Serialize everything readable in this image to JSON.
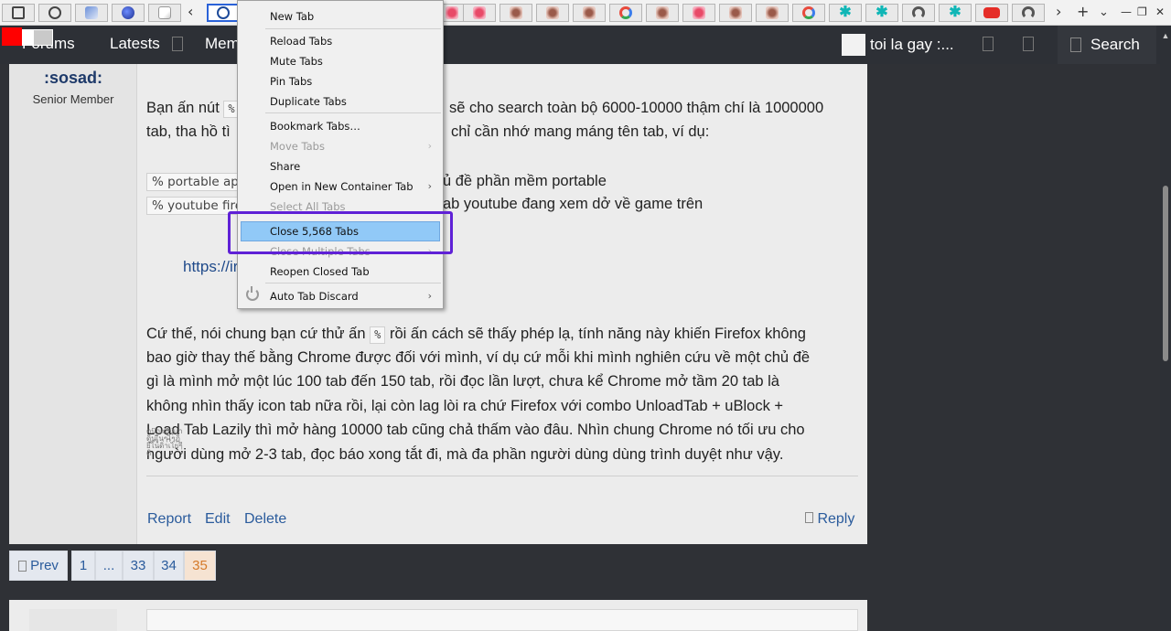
{
  "browser": {
    "tabs": [
      {
        "icon": "puzzle-icon"
      },
      {
        "icon": "gear-icon"
      },
      {
        "icon": "wave-favicon"
      },
      {
        "icon": "globe-favicon"
      },
      {
        "icon": "page-favicon"
      },
      {
        "icon": "wordpress-favicon"
      },
      {
        "icon": "pink-favicon"
      },
      {
        "icon": "pink-favicon"
      },
      {
        "icon": "ameba-favicon"
      },
      {
        "icon": "ameba-favicon"
      },
      {
        "icon": "ameba-favicon"
      },
      {
        "icon": "google-favicon"
      },
      {
        "icon": "ameba-favicon"
      },
      {
        "icon": "pink-favicon"
      },
      {
        "icon": "ameba-favicon"
      },
      {
        "icon": "ameba-favicon"
      },
      {
        "icon": "google-favicon"
      },
      {
        "icon": "star-favicon"
      },
      {
        "icon": "star-favicon"
      },
      {
        "icon": "github-favicon"
      },
      {
        "icon": "star-favicon"
      },
      {
        "icon": "youtube-favicon"
      },
      {
        "icon": "github-favicon"
      }
    ],
    "window_controls": [
      "+",
      "⌄",
      "—",
      "❐",
      "✕"
    ]
  },
  "context_menu": {
    "items": [
      {
        "label": "New Tab",
        "disabled": false,
        "submenu": false
      },
      {
        "label": "Reload Tabs",
        "disabled": false,
        "submenu": false
      },
      {
        "label": "Mute Tabs",
        "disabled": false,
        "submenu": false
      },
      {
        "label": "Pin Tabs",
        "disabled": false,
        "submenu": false
      },
      {
        "label": "Duplicate Tabs",
        "disabled": false,
        "submenu": false
      },
      {
        "label": "Bookmark Tabs…",
        "disabled": false,
        "submenu": false
      },
      {
        "label": "Move Tabs",
        "disabled": true,
        "submenu": true
      },
      {
        "label": "Share",
        "disabled": false,
        "submenu": false
      },
      {
        "label": "Open in New Container Tab",
        "disabled": false,
        "submenu": true
      },
      {
        "label": "Select All Tabs",
        "disabled": true,
        "submenu": false
      },
      {
        "label": "Close 5,568 Tabs",
        "disabled": false,
        "submenu": false,
        "highlighted": true
      },
      {
        "label": "Close Multiple Tabs",
        "disabled": true,
        "submenu": true
      },
      {
        "label": "Reopen Closed Tab",
        "disabled": false,
        "submenu": false
      },
      {
        "label": "Auto Tab Discard",
        "disabled": false,
        "submenu": true
      }
    ]
  },
  "site_header": {
    "forums": "Forums",
    "latests": "Latests",
    "members": "Mem",
    "user_title": "toi la gay :...",
    "search": "Search"
  },
  "post": {
    "author_name": ":sosad:",
    "author_role": "Senior Member",
    "p1_line1_a": "Bạn ấn nút",
    "p1_line1_code": "%",
    "p1_line1_b": "sẽ cho search toàn bộ 6000-10000 thậm chí là 1000000",
    "p1_line2_a": "tab, tha hồ tì",
    "p1_line2_b": "chỉ cần nhớ mang máng tên tab, ví dụ:",
    "code1": "% portable app",
    "code1_desc": "ủ đề phần mềm portable",
    "code2": "% youtube fire",
    "code2_desc": "ab youtube đang xem dở về game trên",
    "link": "https://ir",
    "p2_line1_a": "Cứ thế, nói chung bạn cứ thử ấn",
    "p2_line1_code": "%",
    "p2_line1_b": "rồi ấn cách sẽ thấy phép lạ, tính năng này khiến Firefox không",
    "p2_line2": "bao giờ thay thế bằng Chrome được đối với mình, ví dụ cứ mỗi khi mình nghiên cứu về một chủ đề",
    "p2_line3": "gì là mình mở một lúc 100 tab đến 150 tab, rồi đọc lần lượt, chưa kể Chrome mở tầm 20 tab là",
    "p2_line4": "không nhìn thấy icon tab nữa rồi, lại còn lag lòi ra chứ Firefox với combo UnloadTab + uBlock +",
    "p2_line5": "Load Tab Lazily thì mở hàng 10000 tab cũng chả thấm vào đâu. Nhìn chung Chrome nó tối ưu cho",
    "p2_line6": "người dùng mở 2-3 tab, đọc báo xong tắt đi, mà đa phần người dùng dùng trình duyệt như vậy.",
    "actions": {
      "report": "Report",
      "edit": "Edit",
      "delete": "Delete",
      "reply": "Reply"
    }
  },
  "pagination": {
    "prev": "Prev",
    "pages": [
      "1",
      "...",
      "33",
      "34",
      "35"
    ],
    "current": "35"
  },
  "colors": {
    "accent_highlight": "#5f21d6",
    "menu_selected": "#91c9f7",
    "header_bg": "#2d3036",
    "link": "#2a5b9c",
    "current_page": "#d57a2a"
  }
}
